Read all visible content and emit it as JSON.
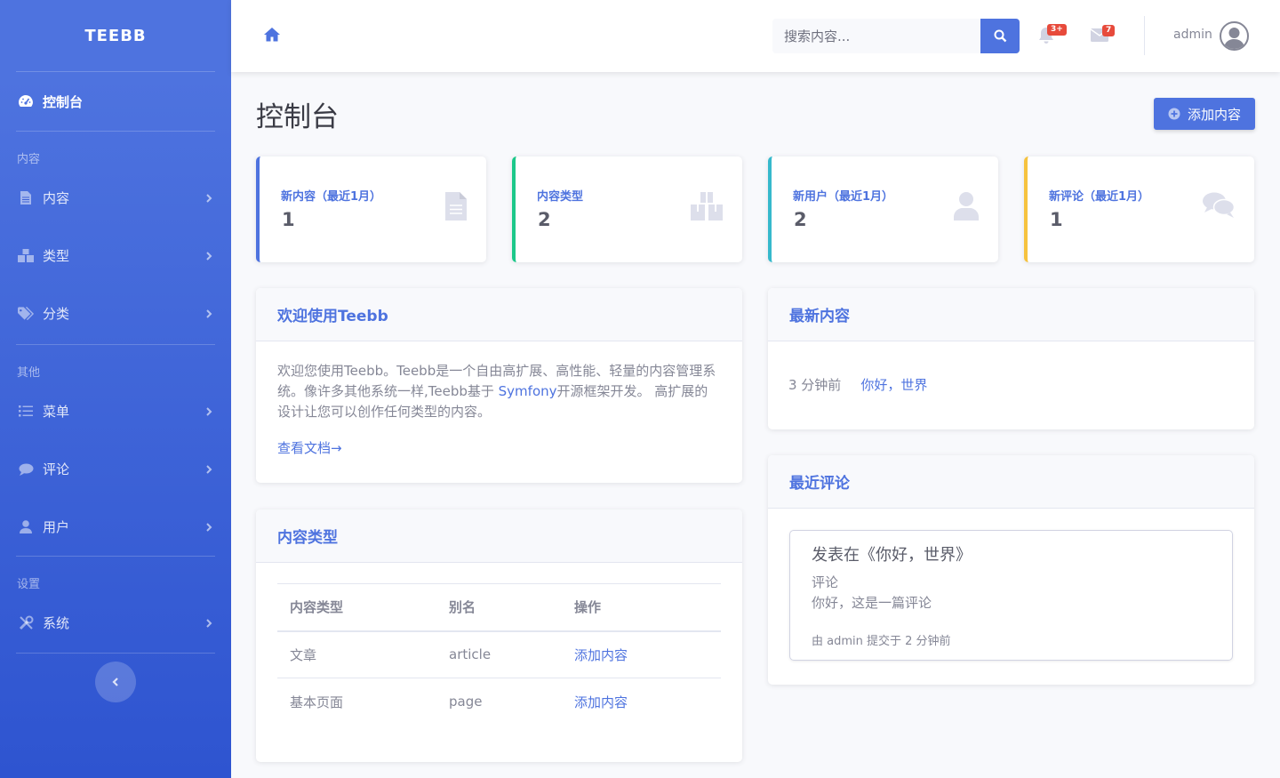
{
  "sidebar": {
    "brand": "TEEBB",
    "dashboard": "控制台",
    "sections": {
      "content": "内容",
      "other": "其他",
      "settings": "设置"
    },
    "items": {
      "content": "内容",
      "types": "类型",
      "taxonomy": "分类",
      "menu": "菜单",
      "comments": "评论",
      "users": "用户",
      "system": "系统"
    }
  },
  "topbar": {
    "search_placeholder": "搜索内容...",
    "alerts_badge": "3+",
    "messages_badge": "7",
    "username": "admin"
  },
  "page": {
    "title": "控制台",
    "add_button": "添加内容"
  },
  "stats": [
    {
      "label": "新内容（最近1月）",
      "value": "1",
      "color": "#4e73df",
      "icon": "file-icon"
    },
    {
      "label": "内容类型",
      "value": "2",
      "color": "#1cc88a",
      "icon": "cubes-icon"
    },
    {
      "label": "新用户（最近1月）",
      "value": "2",
      "color": "#36b9cc",
      "icon": "user-icon"
    },
    {
      "label": "新评论（最近1月）",
      "value": "1",
      "color": "#f6c23e",
      "icon": "comments-icon"
    }
  ],
  "welcome": {
    "title": "欢迎使用Teebb",
    "text_before": "欢迎您使用Teebb。Teebb是一个自由高扩展、高性能、轻量的内容管理系统。像许多其他系统一样,Teebb基于 ",
    "symfony": "Symfony",
    "text_after": "开源框架开发。 高扩展的设计让您可以创作任何类型的内容。",
    "doc_link": "查看文档→"
  },
  "content_types": {
    "title": "内容类型",
    "headers": [
      "内容类型",
      "别名",
      "操作"
    ],
    "rows": [
      {
        "name": "文章",
        "alias": "article",
        "action": "添加内容"
      },
      {
        "name": "基本页面",
        "alias": "page",
        "action": "添加内容"
      }
    ]
  },
  "recent_content": {
    "title": "最新内容",
    "time": "3 分钟前",
    "link": "你好，世界"
  },
  "recent_comments": {
    "title": "最近评论",
    "comment_title": "发表在《你好，世界》",
    "label": "评论",
    "text": "你好，这是一篇评论",
    "meta": "由 admin 提交于 2 分钟前"
  },
  "colors": {
    "primary": "#4e73df",
    "success": "#1cc88a",
    "info": "#36b9cc",
    "warning": "#f6c23e",
    "danger": "#e74a3b"
  }
}
